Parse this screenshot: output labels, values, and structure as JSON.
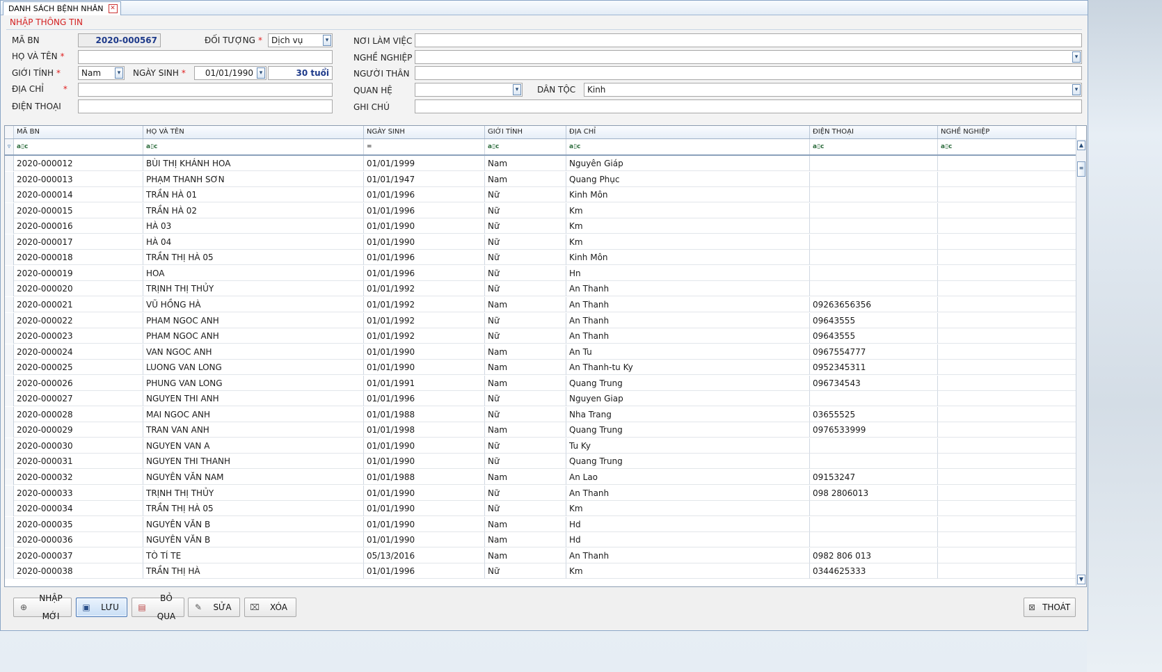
{
  "tab": {
    "title": "DANH SÁCH BỆNH NHÂN"
  },
  "form": {
    "section_title": "NHẬP THÔNG TIN",
    "ma_bn": {
      "label": "MÃ BN",
      "value": "2020-000567"
    },
    "doi_tuong": {
      "label": "ĐỐI TƯỢNG",
      "value": "Dịch vụ"
    },
    "noi_lam_viec": {
      "label": "NƠI LÀM VIỆC",
      "value": ""
    },
    "ho_va_ten": {
      "label": "HỌ VÀ TÊN",
      "value": ""
    },
    "nghe_nghiep": {
      "label": "NGHỀ NGHIỆP",
      "value": ""
    },
    "gioi_tinh": {
      "label": "GIỚI TÍNH",
      "value": "Nam"
    },
    "ngay_sinh": {
      "label": "NGÀY SINH",
      "value": "01/01/1990",
      "age": "30 tuổi"
    },
    "nguoi_than": {
      "label": "NGƯỜI THÂN",
      "value": ""
    },
    "dia_chi": {
      "label": "ĐỊA CHỈ",
      "value": ""
    },
    "quan_he": {
      "label": "QUAN HỆ",
      "value": ""
    },
    "dan_toc": {
      "label": "DÂN TỘC",
      "value": "Kinh"
    },
    "dien_thoai": {
      "label": "ĐIỆN THOẠI",
      "value": ""
    },
    "ghi_chu": {
      "label": "GHI CHÚ",
      "value": ""
    },
    "required_mark": "*"
  },
  "grid": {
    "columns": [
      "MÃ BN",
      "HỌ VÀ TÊN",
      "NGÀY SINH",
      "GIỚI TÍNH",
      "ĐỊA CHỈ",
      "ĐIỆN THOẠI",
      "NGHỀ NGHIỆP"
    ],
    "filters": [
      "a▯c",
      "a▯c",
      "=",
      "a▯c",
      "a▯c",
      "a▯c",
      "a▯c"
    ],
    "filter_icon": "funnel-icon",
    "rows": [
      [
        "2020-000012",
        "BÙI THỊ KHÁNH HOA",
        "01/01/1999",
        "Nam",
        "Nguyên Giáp",
        "",
        ""
      ],
      [
        "2020-000013",
        "PHẠM THANH SƠN",
        "01/01/1947",
        "Nam",
        "Quang Phục",
        "",
        ""
      ],
      [
        "2020-000014",
        "TRẦN HÀ 01",
        "01/01/1996",
        "Nữ",
        "Kinh Môn",
        "",
        ""
      ],
      [
        "2020-000015",
        "TRẦN HÀ 02",
        "01/01/1996",
        "Nữ",
        "Km",
        "",
        ""
      ],
      [
        "2020-000016",
        "HÀ 03",
        "01/01/1990",
        "Nữ",
        "Km",
        "",
        ""
      ],
      [
        "2020-000017",
        "HÀ 04",
        "01/01/1990",
        "Nữ",
        "Km",
        "",
        ""
      ],
      [
        "2020-000018",
        "TRẦN THỊ HÀ 05",
        "01/01/1996",
        "Nữ",
        "Kinh Môn",
        "",
        ""
      ],
      [
        "2020-000019",
        "HOA",
        "01/01/1996",
        "Nữ",
        "Hn",
        "",
        ""
      ],
      [
        "2020-000020",
        "TRỊNH THỊ THỦY",
        "01/01/1992",
        "Nữ",
        "An Thanh",
        "",
        ""
      ],
      [
        "2020-000021",
        "VŨ HỒNG HÀ",
        "01/01/1992",
        "Nam",
        "An Thanh",
        "09263656356",
        ""
      ],
      [
        "2020-000022",
        "PHAM NGOC ANH",
        "01/01/1992",
        "Nữ",
        "An Thanh",
        "09643555",
        ""
      ],
      [
        "2020-000023",
        "PHAM NGOC ANH",
        "01/01/1992",
        "Nữ",
        "An Thanh",
        "09643555",
        ""
      ],
      [
        "2020-000024",
        "VAN NGOC ANH",
        "01/01/1990",
        "Nam",
        "An Tu",
        "0967554777",
        ""
      ],
      [
        "2020-000025",
        "LUONG VAN LONG",
        "01/01/1990",
        "Nam",
        "An Thanh-tu Ky",
        "0952345311",
        ""
      ],
      [
        "2020-000026",
        "PHUNG VAN LONG",
        "01/01/1991",
        "Nam",
        "Quang Trung",
        "096734543",
        ""
      ],
      [
        "2020-000027",
        "NGUYEN THI ANH",
        "01/01/1996",
        "Nữ",
        "Nguyen Giap",
        "",
        ""
      ],
      [
        "2020-000028",
        "MAI NGOC ANH",
        "01/01/1988",
        "Nữ",
        "Nha Trang",
        "03655525",
        ""
      ],
      [
        "2020-000029",
        "TRAN VAN ANH",
        "01/01/1998",
        "Nam",
        "Quang Trung",
        "0976533999",
        ""
      ],
      [
        "2020-000030",
        "NGUYEN VAN A",
        "01/01/1990",
        "Nữ",
        "Tu Ky",
        "",
        ""
      ],
      [
        "2020-000031",
        "NGUYEN THI THANH",
        "01/01/1990",
        "Nữ",
        "Quang Trung",
        "",
        ""
      ],
      [
        "2020-000032",
        "NGUYÊN VĂN NAM",
        "01/01/1988",
        "Nam",
        "An Lao",
        "09153247",
        ""
      ],
      [
        "2020-000033",
        "TRỊNH THỊ THỦY",
        "01/01/1990",
        "Nữ",
        "An Thanh",
        "098 2806013",
        ""
      ],
      [
        "2020-000034",
        "TRẦN THỊ HÀ 05",
        "01/01/1990",
        "Nữ",
        "Km",
        "",
        ""
      ],
      [
        "2020-000035",
        "NGUYÊN VĂN B",
        "01/01/1990",
        "Nam",
        "Hd",
        "",
        ""
      ],
      [
        "2020-000036",
        "NGUYÊN VĂN B",
        "01/01/1990",
        "Nam",
        "Hd",
        "",
        ""
      ],
      [
        "2020-000037",
        "TÒ TÍ TE",
        "05/13/2016",
        "Nam",
        "An Thanh",
        "0982 806 013",
        ""
      ],
      [
        "2020-000038",
        "TRẦN THỊ HÀ",
        "01/01/1996",
        "Nữ",
        "Km",
        "0344625333",
        ""
      ]
    ]
  },
  "toolbar": {
    "nhap_moi": "NHẬP MỚI",
    "luu": "LƯU",
    "bo_qua": "BỎ QUA",
    "sua": "SỬA",
    "xoa": "XÓA",
    "thoat": "THOÁT"
  }
}
